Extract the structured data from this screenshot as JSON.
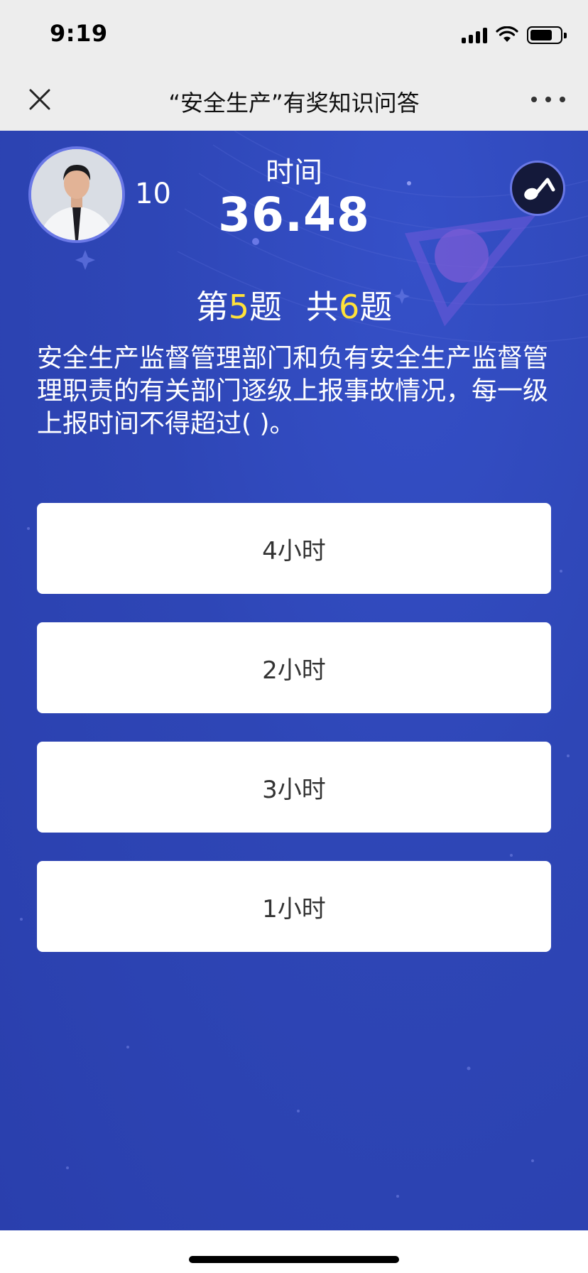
{
  "status_bar": {
    "time": "9:19"
  },
  "nav": {
    "title": "“安全生产”有奖知识问答"
  },
  "player": {
    "score": "10"
  },
  "timer": {
    "label": "时间",
    "value": "36.48"
  },
  "progress": {
    "prefix": "第",
    "current": "5",
    "middle": "题",
    "total_prefix": "共",
    "total": "6",
    "suffix": "题"
  },
  "question": {
    "text": "安全生产监督管理部门和负有安全生产监督管理职责的有关部门逐级上报事故情况，每一级上报时间不得超过( )。"
  },
  "options": [
    {
      "label": "4小时"
    },
    {
      "label": "2小时"
    },
    {
      "label": "3小时"
    },
    {
      "label": "1小时"
    }
  ],
  "colors": {
    "background": "#2e46b6",
    "highlight": "#ffe23a",
    "option_bg": "#ffffff"
  },
  "icons": {
    "close": "close-icon",
    "more": "more-icon",
    "music": "music-note-icon"
  }
}
